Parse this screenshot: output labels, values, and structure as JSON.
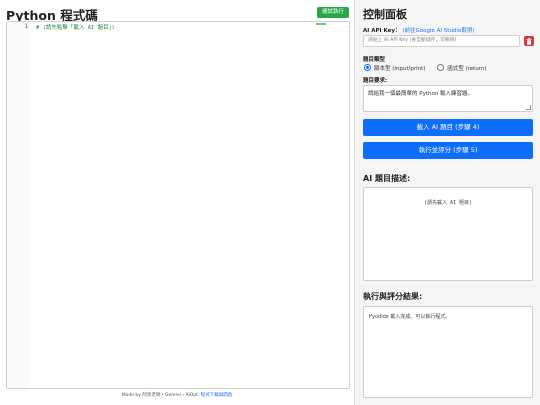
{
  "editor": {
    "title": "Python 程式碼",
    "run_button": "儲試執行",
    "line_number": "1",
    "code": "# (請先點擊「載入 AI 題目」)"
  },
  "footer": {
    "prefix": "Made by 阿亮老師・Gemini・AIOpt.",
    "link": "程式下載與開啟"
  },
  "panel": {
    "title": "控制面板",
    "api_key_label": "AI API Key：",
    "api_key_link": "(前往Google AI Studio取得)",
    "api_key_placeholder": "請貼上 AI API Key (會自動儲存，可刪除)",
    "trash_icon": "trash-icon",
    "type_label": "題目類型",
    "type_options": [
      {
        "label": "腳本型 (input/print)",
        "selected": true
      },
      {
        "label": "函式型 (return)",
        "selected": false
      }
    ],
    "req_label": "題目要求:",
    "req_value": "請給我一個最簡單的 Python 輸入練習題。",
    "load_button": "載入 AI 題目 (步驟 4)",
    "grade_button": "執行並評分 (步驟 5)",
    "desc_title": "AI 題目描述:",
    "desc_placeholder": "(請先載入 AI 題目)",
    "result_title": "執行與評分結果:",
    "result_text": "Pyodide 載入完成。可以執行程式。",
    "accent_color": "#0d6efd",
    "run_color": "#28a745",
    "danger_color": "#dc3545"
  }
}
